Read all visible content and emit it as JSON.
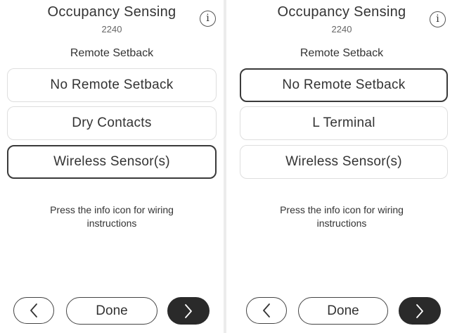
{
  "left": {
    "title": "Occupancy Sensing",
    "code": "2240",
    "info_icon_glyph": "i",
    "section_label": "Remote Setback",
    "options": [
      {
        "label": "No Remote Setback",
        "selected": false
      },
      {
        "label": "Dry Contacts",
        "selected": false
      },
      {
        "label": "Wireless Sensor(s)",
        "selected": true
      }
    ],
    "hint_line1": "Press the info icon for wiring",
    "hint_line2": "instructions",
    "done_label": "Done"
  },
  "right": {
    "title": "Occupancy Sensing",
    "code": "2240",
    "info_icon_glyph": "i",
    "section_label": "Remote Setback",
    "options": [
      {
        "label": "No Remote Setback",
        "selected": true
      },
      {
        "label": "L Terminal",
        "selected": false
      },
      {
        "label": "Wireless Sensor(s)",
        "selected": false
      }
    ],
    "hint_line1": "Press the info icon for wiring",
    "hint_line2": "instructions",
    "done_label": "Done"
  },
  "icons": {
    "back": "chevron-left-icon",
    "next": "chevron-right-icon",
    "info": "info-icon"
  },
  "colors": {
    "background": "#ffffff",
    "selected_border": "#3a3a3a",
    "option_border": "#dedede",
    "next_button_fill": "#2a2a2a"
  }
}
